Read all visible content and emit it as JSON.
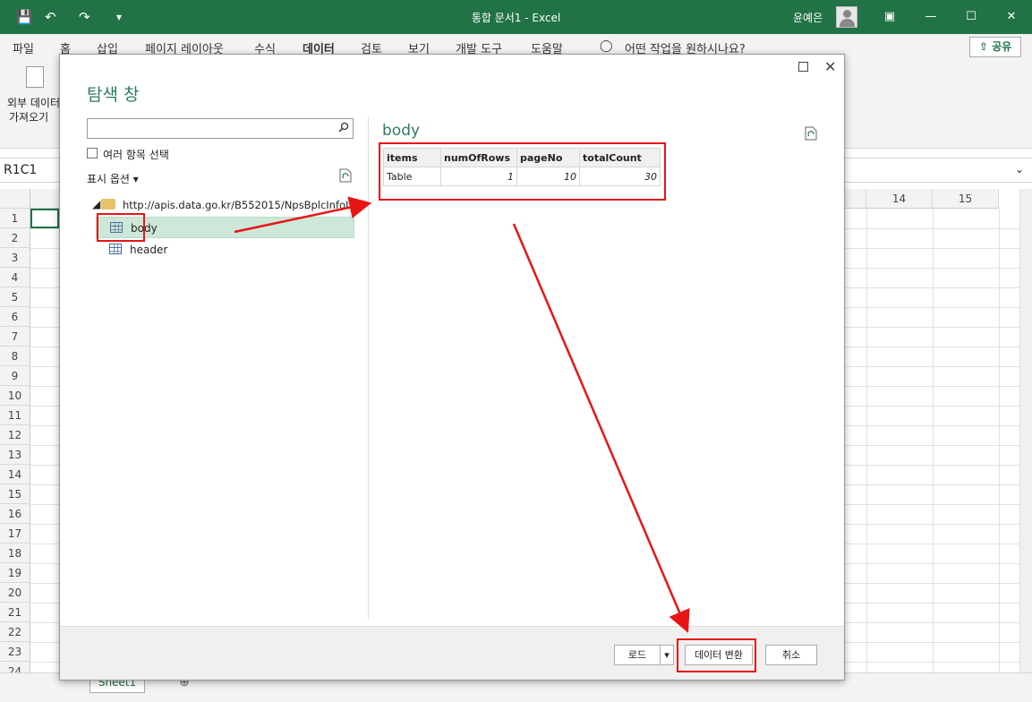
{
  "titlebar": {
    "title": "통합 문서1  -  Excel",
    "user": "윤예은",
    "save_icon": "save-icon",
    "undo_icon": "undo-icon",
    "redo_icon": "redo-icon"
  },
  "menu": {
    "items": [
      "파일",
      "홈",
      "삽입",
      "페이지 레이아웃",
      "수식",
      "데이터",
      "검토",
      "보기",
      "개발 도구",
      "도움말"
    ],
    "active": "데이터",
    "tell_me": "어떤 작업을 원하시나요?",
    "share": "공유"
  },
  "ribbon": {
    "external_data_line1": "외부 데이터",
    "external_data_line2": "가져오기"
  },
  "namebox": "R1C1",
  "grid": {
    "rows": [
      "1",
      "2",
      "3",
      "4",
      "5",
      "6",
      "7",
      "8",
      "9",
      "10",
      "11",
      "12",
      "13",
      "14",
      "15",
      "16",
      "17",
      "18",
      "19",
      "20",
      "21",
      "22",
      "23",
      "24"
    ],
    "cols_visible": [
      "14",
      "15"
    ]
  },
  "sheet_tab": "Sheet1",
  "dialog": {
    "title": "탐색 창",
    "search_placeholder": "",
    "multi_select_label": "여러 항목 선택",
    "display_options": "표시 옵션",
    "tree_root_url": "http://apis.data.go.kr/B552015/NpsBplcInfoInq",
    "tree_items": [
      "body",
      "header"
    ],
    "preview_title": "body",
    "table": {
      "columns": [
        "items",
        "numOfRows",
        "pageNo",
        "totalCount"
      ],
      "rows": [
        [
          "Table",
          "1",
          "10",
          "30"
        ]
      ]
    },
    "buttons": {
      "load": "로드",
      "transform": "데이터 변환",
      "cancel": "취소"
    }
  },
  "colors": {
    "excel_green": "#217346",
    "accent_title": "#2e7d5b",
    "annotation_red": "#e81416",
    "selection": "#cde8d8"
  }
}
